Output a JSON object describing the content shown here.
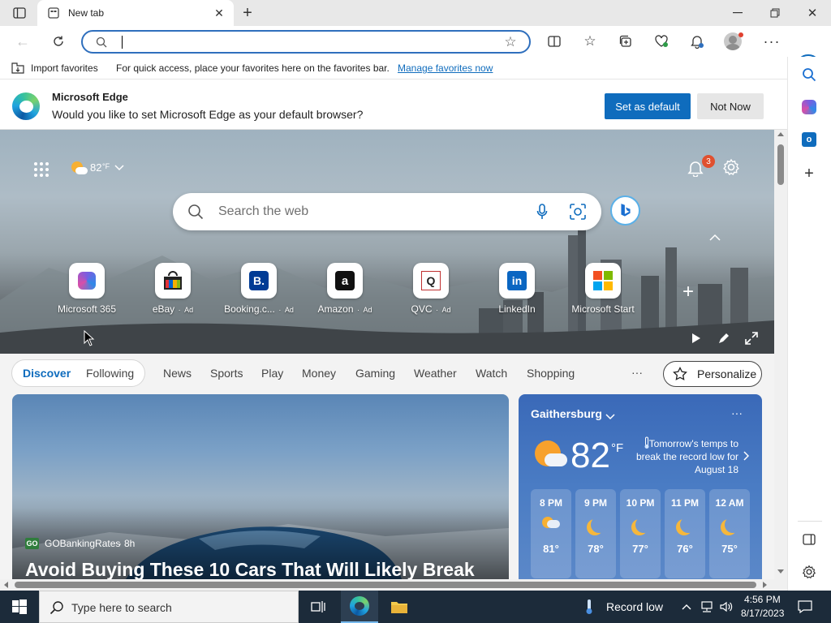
{
  "browser": {
    "tab_title": "New tab",
    "omnibox_value": "",
    "favorites_bar": {
      "import_label": "Import favorites",
      "hint_text": "For quick access, place your favorites here on the favorites bar.",
      "manage_link": "Manage favorites now"
    },
    "infobar": {
      "title": "Microsoft Edge",
      "message": "Would you like to set Microsoft Edge as your default browser?",
      "set_default_label": "Set as default",
      "not_now_label": "Not Now"
    }
  },
  "newtab": {
    "weather_temp": "82",
    "weather_unit": "°F",
    "notification_count": "3",
    "search_placeholder": "Search the web",
    "quick_links": [
      {
        "label": "Microsoft 365",
        "ad": ""
      },
      {
        "label": "eBay",
        "ad": "Ad"
      },
      {
        "label": "Booking.c...",
        "ad": "Ad"
      },
      {
        "label": "Amazon",
        "ad": "Ad"
      },
      {
        "label": "QVC",
        "ad": "Ad"
      },
      {
        "label": "LinkedIn",
        "ad": ""
      },
      {
        "label": "Microsoft Start",
        "ad": ""
      }
    ],
    "tabs": {
      "discover": "Discover",
      "following": "Following",
      "categories": [
        "News",
        "Sports",
        "Play",
        "Money",
        "Gaming",
        "Weather",
        "Watch",
        "Shopping"
      ],
      "more": "···",
      "personalize": "Personalize"
    },
    "article": {
      "source_logo": "GO",
      "source": "GOBankingRates",
      "age": "8h",
      "headline": "Avoid Buying These 10 Cars That Will Likely Break"
    },
    "weather_card": {
      "location": "Gaithersburg",
      "more": "···",
      "temp": "82",
      "unit": "°F",
      "alert": "Tomorrow's temps to break the record low for August 18",
      "hourly": [
        {
          "time": "8 PM",
          "temp": "81°",
          "icon": "partly-cloudy-night-icon"
        },
        {
          "time": "9 PM",
          "temp": "78°",
          "icon": "moon-icon"
        },
        {
          "time": "10 PM",
          "temp": "77°",
          "icon": "moon-icon"
        },
        {
          "time": "11 PM",
          "temp": "76°",
          "icon": "moon-icon"
        },
        {
          "time": "12 AM",
          "temp": "75°",
          "icon": "moon-icon"
        }
      ]
    }
  },
  "taskbar": {
    "search_placeholder": "Type here to search",
    "weather_text": "Record low",
    "time": "4:56 PM",
    "date": "8/17/2023"
  },
  "colors": {
    "accent": "#0f6cbd",
    "taskbar": "#1c2b3a",
    "badge": "#e0502f"
  }
}
